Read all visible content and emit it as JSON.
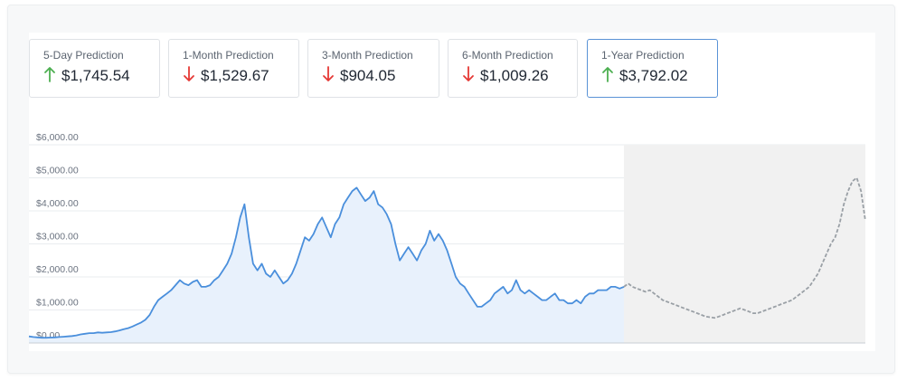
{
  "predictions": [
    {
      "label": "5-Day Prediction",
      "value": "$1,745.54",
      "direction": "up",
      "active": false
    },
    {
      "label": "1-Month Prediction",
      "value": "$1,529.67",
      "direction": "down",
      "active": false
    },
    {
      "label": "3-Month Prediction",
      "value": "$904.05",
      "direction": "down",
      "active": false
    },
    {
      "label": "6-Month Prediction",
      "value": "$1,009.26",
      "direction": "down",
      "active": false
    },
    {
      "label": "1-Year Prediction",
      "value": "$3,792.02",
      "direction": "up",
      "active": true
    }
  ],
  "colors": {
    "up": "#4caf50",
    "down": "#e53935",
    "history": "#4a8fdc",
    "history_fill": "#e8f1fc",
    "forecast": "#9aa0a6",
    "forecast_fill": "#f1f1f1",
    "grid": "#e9ecef",
    "accent": "#5a93d6"
  },
  "chart_data": {
    "type": "area",
    "title": "",
    "xlabel": "",
    "ylabel": "",
    "ylim": [
      0,
      6000
    ],
    "yticks": [
      "$0.00",
      "$1,000.00",
      "$2,000.00",
      "$3,000.00",
      "$4,000.00",
      "$5,000.00",
      "$6,000.00"
    ],
    "grid": true,
    "series": [
      {
        "style": "solid",
        "values": [
          200,
          180,
          170,
          160,
          160,
          165,
          170,
          180,
          190,
          200,
          210,
          230,
          260,
          280,
          300,
          300,
          320,
          310,
          320,
          330,
          350,
          380,
          420,
          450,
          500,
          560,
          620,
          700,
          850,
          1100,
          1300,
          1400,
          1500,
          1600,
          1750,
          1900,
          1800,
          1750,
          1850,
          1900,
          1700,
          1700,
          1750,
          1900,
          2000,
          2200,
          2400,
          2700,
          3200,
          3800,
          4200,
          3200,
          2400,
          2200,
          2400,
          2100,
          2000,
          2200,
          2000,
          1800,
          1900,
          2100,
          2400,
          2800,
          3200,
          3100,
          3300,
          3600,
          3800,
          3500,
          3200,
          3600,
          3800,
          4200,
          4400,
          4600,
          4700,
          4500,
          4300,
          4400,
          4600,
          4200,
          4100,
          3900,
          3600,
          3000,
          2500,
          2700,
          2900,
          2700,
          2500,
          2800,
          3000,
          3400,
          3100,
          3300,
          3100,
          2800,
          2400,
          2000,
          1800,
          1700,
          1500,
          1300,
          1100,
          1100,
          1200,
          1300,
          1500,
          1600,
          1700,
          1500,
          1600,
          1900,
          1600,
          1500,
          1600,
          1500,
          1400,
          1300,
          1300,
          1400,
          1500,
          1300,
          1300,
          1200,
          1200,
          1300,
          1200,
          1400,
          1500,
          1500,
          1600,
          1600,
          1600,
          1700,
          1700,
          1650,
          1700
        ]
      },
      {
        "style": "dashed",
        "values": [
          1700,
          1800,
          1700,
          1650,
          1600,
          1550,
          1600,
          1500,
          1400,
          1300,
          1250,
          1200,
          1150,
          1100,
          1050,
          1000,
          950,
          900,
          850,
          800,
          780,
          760,
          800,
          850,
          900,
          950,
          1000,
          1050,
          1000,
          950,
          900,
          900,
          950,
          1000,
          1050,
          1100,
          1150,
          1200,
          1250,
          1300,
          1400,
          1500,
          1600,
          1700,
          1900,
          2100,
          2400,
          2700,
          3000,
          3200,
          3600,
          4200,
          4600,
          4900,
          5000,
          4600,
          3700
        ]
      }
    ]
  }
}
